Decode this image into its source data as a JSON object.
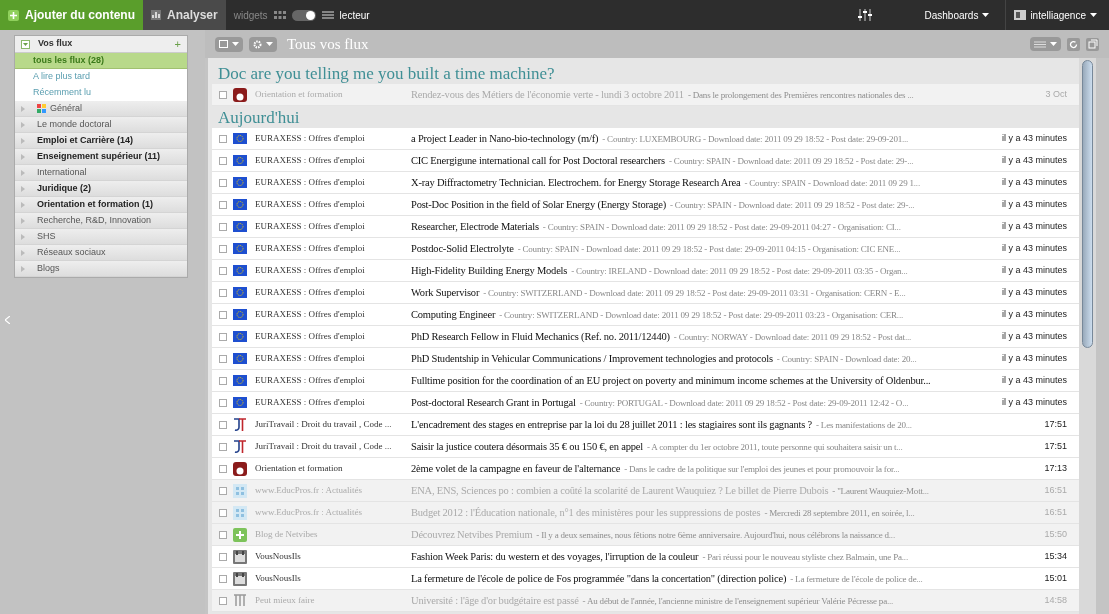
{
  "topbar": {
    "add_button": "Ajouter du contenu",
    "analyze_button": "Analyser",
    "view_left": "widgets",
    "view_right": "lecteur",
    "reader_mode": true,
    "dashboards": "Dashboards",
    "account": "intelliagence"
  },
  "sidebar": {
    "header": "Vos flux",
    "add": "+",
    "expanded": true,
    "views": [
      {
        "label": "tous les flux (28)",
        "selected": true
      },
      {
        "label": "A lire plus tard",
        "selected": false
      },
      {
        "label": "Récemment lu",
        "selected": false
      }
    ],
    "categories": [
      {
        "label": "Général",
        "unread": false,
        "icon": true
      },
      {
        "label": "Le monde doctoral",
        "unread": false,
        "icon": false
      },
      {
        "label": "Emploi et Carrière (14)",
        "unread": true,
        "icon": false
      },
      {
        "label": "Enseignement supérieur (11)",
        "unread": true,
        "icon": false
      },
      {
        "label": "International",
        "unread": false,
        "icon": false
      },
      {
        "label": "Juridique (2)",
        "unread": true,
        "icon": false
      },
      {
        "label": "Orientation et formation (1)",
        "unread": true,
        "icon": false
      },
      {
        "label": "Recherche, R&D, Innovation",
        "unread": false,
        "icon": false
      },
      {
        "label": "SHS",
        "unread": false,
        "icon": false
      },
      {
        "label": "Réseaux sociaux",
        "unread": false,
        "icon": false
      },
      {
        "label": "Blogs",
        "unread": false,
        "icon": false
      }
    ]
  },
  "toolbar": {
    "title": "Tous vos flux"
  },
  "sections": [
    {
      "title": "Doc are you telling me you built a time machine?",
      "items": [
        {
          "source": "Orientation et formation",
          "kind": "orientation",
          "title": "Rendez-vous des Métiers de l'économie verte - lundi 3 octobre 2011",
          "snippet": "- Dans le prolongement des Premières rencontres nationales des ...",
          "time": "3 Oct",
          "read": true
        }
      ]
    },
    {
      "title": "Aujourd'hui",
      "items": [
        {
          "source": "EURAXESS : Offres d'emploi",
          "kind": "eu",
          "title": "a Project Leader in Nano-bio-technology (m/f)",
          "snippet": "- Country: LUXEMBOURG - Download date: 2011 09 29 18:52 - Post date: 29-09-201...",
          "time": "il y a 43 minutes",
          "read": false
        },
        {
          "source": "EURAXESS : Offres d'emploi",
          "kind": "eu",
          "title": "CIC Energigune international call for Post Doctoral researchers",
          "snippet": "- Country: SPAIN - Download date: 2011 09 29 18:52 - Post date: 29-...",
          "time": "il y a 43 minutes",
          "read": false
        },
        {
          "source": "EURAXESS : Offres d'emploi",
          "kind": "eu",
          "title": "X-ray Diffractometry Technician. Electrochem. for Energy Storage Research Area",
          "snippet": "- Country: SPAIN - Download date: 2011 09 29 1...",
          "time": "il y a 43 minutes",
          "read": false
        },
        {
          "source": "EURAXESS : Offres d'emploi",
          "kind": "eu",
          "title": "Post-Doc Position in the field of Solar Energy (Energy Storage)",
          "snippet": "- Country: SPAIN - Download date: 2011 09 29 18:52 - Post date: 29-...",
          "time": "il y a 43 minutes",
          "read": false
        },
        {
          "source": "EURAXESS : Offres d'emploi",
          "kind": "eu",
          "title": "Researcher, Electrode Materials",
          "snippet": "- Country: SPAIN - Download date: 2011 09 29 18:52 - Post date: 29-09-2011 04:27 - Organisation: CI...",
          "time": "il y a 43 minutes",
          "read": false
        },
        {
          "source": "EURAXESS : Offres d'emploi",
          "kind": "eu",
          "title": "Postdoc-Solid Electrolyte",
          "snippet": "- Country: SPAIN - Download date: 2011 09 29 18:52 - Post date: 29-09-2011 04:15 - Organisation: CIC ENE...",
          "time": "il y a 43 minutes",
          "read": false
        },
        {
          "source": "EURAXESS : Offres d'emploi",
          "kind": "eu",
          "title": "High-Fidelity Building Energy Models",
          "snippet": "- Country: IRELAND - Download date: 2011 09 29 18:52 - Post date: 29-09-2011 03:35 - Organ...",
          "time": "il y a 43 minutes",
          "read": false
        },
        {
          "source": "EURAXESS : Offres d'emploi",
          "kind": "eu",
          "title": "Work Supervisor",
          "snippet": "- Country: SWITZERLAND - Download date: 2011 09 29 18:52 - Post date: 29-09-2011 03:31 - Organisation: CERN - E...",
          "time": "il y a 43 minutes",
          "read": false
        },
        {
          "source": "EURAXESS : Offres d'emploi",
          "kind": "eu",
          "title": "Computing Engineer",
          "snippet": "- Country: SWITZERLAND - Download date: 2011 09 29 18:52 - Post date: 29-09-2011 03:23 - Organisation: CER...",
          "time": "il y a 43 minutes",
          "read": false
        },
        {
          "source": "EURAXESS : Offres d'emploi",
          "kind": "eu",
          "title": "PhD Research Fellow in Fluid Mechanics (Ref. no. 2011/12440)",
          "snippet": "- Country: NORWAY - Download date: 2011 09 29 18:52 - Post dat...",
          "time": "il y a 43 minutes",
          "read": false
        },
        {
          "source": "EURAXESS : Offres d'emploi",
          "kind": "eu",
          "title": "PhD Studentship in Vehicular Communications / Improvement technologies and protocols",
          "snippet": "- Country: SPAIN - Download date: 20...",
          "time": "il y a 43 minutes",
          "read": false
        },
        {
          "source": "EURAXESS : Offres d'emploi",
          "kind": "eu",
          "title": "Fulltime position for the coordination of an EU project on poverty and minimum income schemes at the University of Oldenbur...",
          "time": "il y a 43 minutes",
          "read": false
        },
        {
          "source": "EURAXESS : Offres d'emploi",
          "kind": "eu",
          "title": "Post-doctoral Research Grant in Portugal",
          "snippet": "- Country: PORTUGAL - Download date: 2011 09 29 18:52 - Post date: 29-09-2011 12:42 - O...",
          "time": "il y a 43 minutes",
          "read": false
        },
        {
          "source": "JuriTravail : Droit du travail , Code ...",
          "kind": "jt",
          "title": "L'encadrement des stages en entreprise par la loi du 28 juillet 2011 : les stagiaires sont ils gagnants ?",
          "snippet": "- Les manifestations de 20...",
          "time": "17:51",
          "read": false
        },
        {
          "source": "JuriTravail : Droit du travail , Code ...",
          "kind": "jt",
          "title": "Saisir la justice coutera désormais 35 € ou 150 €, en appel",
          "snippet": "- A compter du 1er octobre 2011, toute personne qui souhaitera saisir un t...",
          "time": "17:51",
          "read": false
        },
        {
          "source": "Orientation et formation",
          "kind": "orientation",
          "title": "2ème volet de la campagne en faveur de l'alternance",
          "snippet": "- Dans le cadre de la politique sur l'emploi des jeunes et pour promouvoir la for...",
          "time": "17:13",
          "read": false
        },
        {
          "source": "www.EducPros.fr : Actualités",
          "kind": "educpros",
          "title": "ENA, ENS, Sciences po : combien a coûté la scolarité de Laurent Wauquiez ? Le billet de Pierre Dubois",
          "snippet": "- \"Laurent Wauquiez-Mott...",
          "time": "16:51",
          "read": true
        },
        {
          "source": "www.EducPros.fr : Actualités",
          "kind": "educpros",
          "title": "Budget 2012 : l'Éducation nationale, n°1 des ministères pour les suppressions de postes",
          "snippet": "- Mercredi 28 septembre 2011, en soirée, l...",
          "time": "16:51",
          "read": true
        },
        {
          "source": "Blog de Netvibes",
          "kind": "netvibes",
          "title": "Découvrez Netvibes Premium",
          "snippet": "- Il y a deux semaines, nous fêtions notre 6ème anniversaire. Aujourd'hui, nous célébrons la naissance d...",
          "time": "15:50",
          "read": true
        },
        {
          "source": "VousNousIls",
          "kind": "vni",
          "title": "Fashion Week Paris: du western et des voyages, l'irruption de la couleur",
          "snippet": "- Pari réussi pour le nouveau styliste chez Balmain, une Pa...",
          "time": "15:34",
          "read": false
        },
        {
          "source": "VousNousIls",
          "kind": "vni",
          "title": "La fermeture de l'école de police de Fos programmée \"dans la concertation\" (direction police)",
          "snippet": "- La fermeture de l'école de police de...",
          "time": "15:01",
          "read": false
        },
        {
          "source": "Peut mieux faire",
          "kind": "pmf",
          "title": "Université : l'âge d'or budgétaire est passé",
          "snippet": "- Au début de l'année, l'ancienne ministre de l'enseignement supérieur Valérie Pécresse pa...",
          "time": "14:58",
          "read": true
        }
      ]
    }
  ]
}
